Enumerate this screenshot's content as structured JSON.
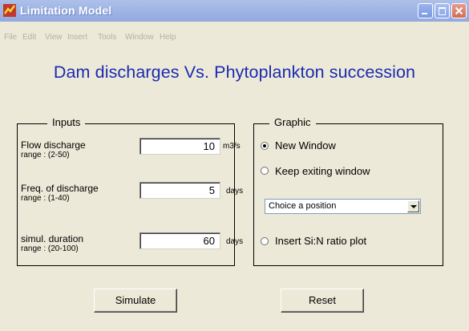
{
  "window": {
    "title": "Limitation Model"
  },
  "menu": [
    "File",
    "Edit",
    "View",
    "Insert",
    "Tools",
    "Window",
    "Help"
  ],
  "heading": "Dam discharges Vs. Phytoplankton succession",
  "inputs": {
    "group_label": "Inputs",
    "fields": [
      {
        "label": "Flow discharge",
        "range": "range : (2-50)",
        "value": "10",
        "unit": "m3/s"
      },
      {
        "label": "Freq. of discharge",
        "range": "range : (1-40)",
        "value": "5",
        "unit": "days"
      },
      {
        "label": "simul. duration",
        "range": "range : (20-100)",
        "value": "60",
        "unit": "days"
      }
    ]
  },
  "graphic": {
    "group_label": "Graphic",
    "new_window": {
      "label": "New Window",
      "selected": true
    },
    "keep_window": {
      "label": "Keep exiting window",
      "selected": false
    },
    "position_select": {
      "value": "Choice a position"
    },
    "si_n_plot": {
      "label": "Insert Si:N ratio plot",
      "selected": false
    }
  },
  "buttons": {
    "simulate": "Simulate",
    "reset": "Reset"
  },
  "colors": {
    "heading": "#1b2bb0",
    "titlebar": "#9fb4e4",
    "window_bg": "#ece9d8"
  }
}
